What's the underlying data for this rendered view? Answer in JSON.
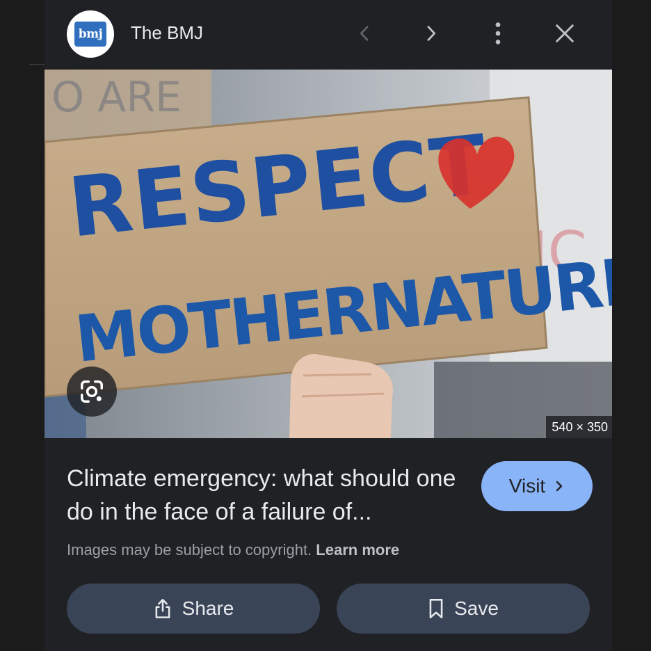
{
  "header": {
    "logo_text": "bmj",
    "site_name": "The BMJ",
    "icons": [
      "chevron-left-icon",
      "chevron-right-icon",
      "more-vert-icon",
      "close-icon"
    ]
  },
  "image": {
    "sign_line1": "RESPECT",
    "sign_line2": "MOTHERNATURE",
    "dimensions": "540 × 350",
    "lens_icon": "google-lens-icon"
  },
  "result": {
    "title": "Climate emergency: what should one do in the face of a failure of...",
    "visit_label": "Visit",
    "copyright_text": "Images may be subject to copyright.",
    "learn_more": "Learn more"
  },
  "actions": {
    "share_label": "Share",
    "save_label": "Save"
  },
  "colors": {
    "background": "#202124",
    "accent": "#8ab4f8",
    "button": "#394457",
    "text": "#e8eaed",
    "muted": "#9aa0a6"
  }
}
